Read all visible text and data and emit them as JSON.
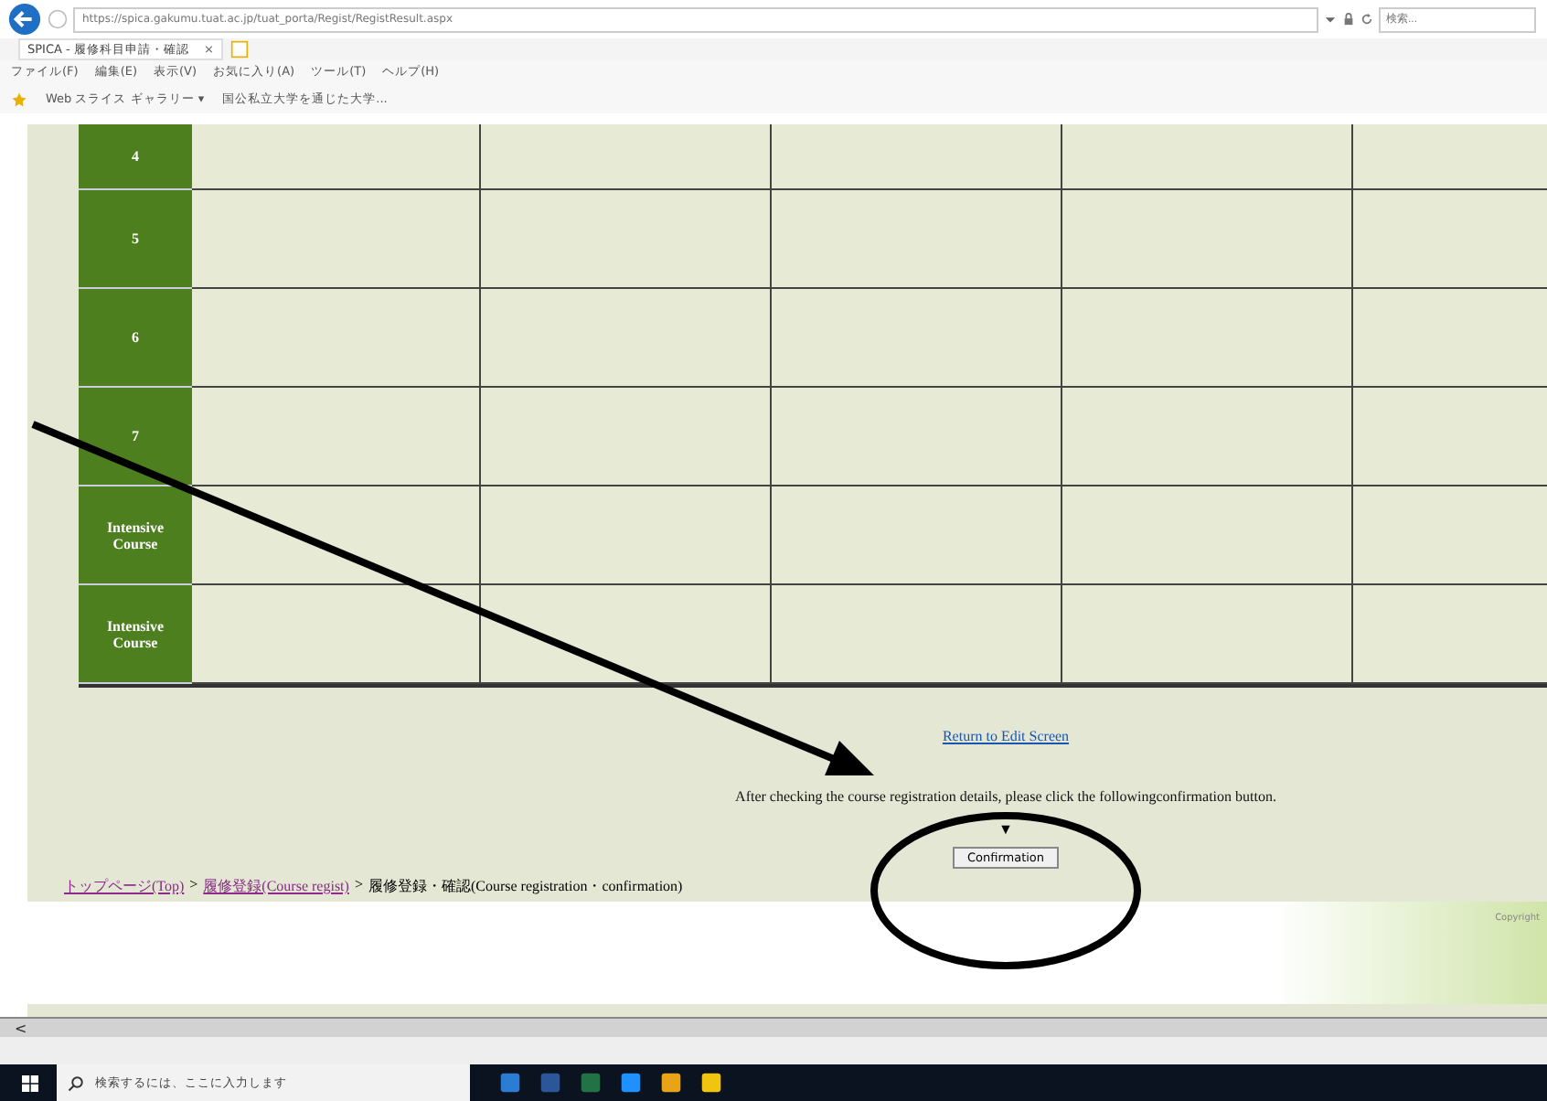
{
  "browser": {
    "url": "https://spica.gakumu.tuat.ac.jp/tuat_porta/Regist/RegistResult.aspx",
    "search_placeholder": "検索...",
    "tab": "SPICA - 履修科目申請・確認",
    "tab_close": "×",
    "menu": [
      "ファイル(F)",
      "編集(E)",
      "表示(V)",
      "お気に入り(A)",
      "ツール(T)",
      "ヘルプ(H)"
    ],
    "favorites": [
      {
        "label": "Web スライス ギャラリー ▾"
      },
      {
        "label": "国公私立大学を通じた大学..."
      }
    ]
  },
  "table": {
    "rows": [
      {
        "period": "4"
      },
      {
        "period": "5"
      },
      {
        "period": "6"
      },
      {
        "period": "7"
      },
      {
        "period": "Intensive Course"
      },
      {
        "period": "Intensive Course"
      }
    ]
  },
  "return_link": "Return to Edit Screen",
  "instruction": "After checking the course registration details, please click the followingconfirmation button.",
  "pointer": "▼",
  "confirm_button": "Confirmation",
  "breadcrumb": [
    {
      "label": "トップページ(Top)",
      "link": true
    },
    {
      "label": "履修登録(Course regist)",
      "link": true
    },
    {
      "label": "履修登録・確認(Course registration・confirmation)",
      "link": false
    }
  ],
  "breadcrumb_separator": ">",
  "footer": {
    "copyright": "Copyright"
  },
  "scroll_left": "<",
  "taskbar": {
    "search_placeholder": "検索するには、ここに入力します"
  }
}
